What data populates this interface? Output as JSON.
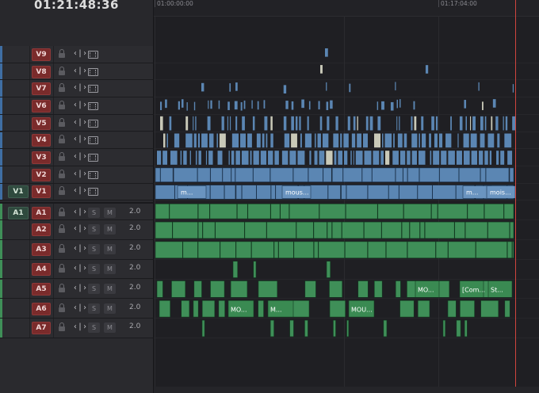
{
  "timecode": "01:21:48:36",
  "ruler": {
    "labels": [
      "01:00:00:00",
      "01:17:04:00"
    ]
  },
  "video_tracks": [
    {
      "label": "V9"
    },
    {
      "label": "V8"
    },
    {
      "label": "V7"
    },
    {
      "label": "V6"
    },
    {
      "label": "V5"
    },
    {
      "label": "V4"
    },
    {
      "label": "V3"
    },
    {
      "label": "V2"
    },
    {
      "label": "V1",
      "patch": "V1"
    }
  ],
  "audio_tracks": [
    {
      "label": "A1",
      "patch": "A1",
      "volume": "2.0"
    },
    {
      "label": "A2",
      "volume": "2.0"
    },
    {
      "label": "A3",
      "volume": "2.0"
    },
    {
      "label": "A4",
      "volume": "2.0"
    },
    {
      "label": "A5",
      "volume": "2.0"
    },
    {
      "label": "A6",
      "volume": "2.0"
    },
    {
      "label": "A7",
      "volume": "2.0"
    }
  ],
  "solo_label": "S",
  "mute_label": "M",
  "link_glyph": "‹|›",
  "clip_labels": {
    "v1": [
      "m...",
      "mous...",
      "m...",
      "mois..."
    ],
    "a5": [
      "MO...",
      "[Com...",
      "St..."
    ],
    "a6": [
      "MO...",
      "M...",
      "MOU..."
    ]
  },
  "colors": {
    "video_clip": "#5b86b3",
    "audio_clip": "#3f8f58",
    "track_badge": "#7a2b2b",
    "playhead": "#d0453e"
  }
}
